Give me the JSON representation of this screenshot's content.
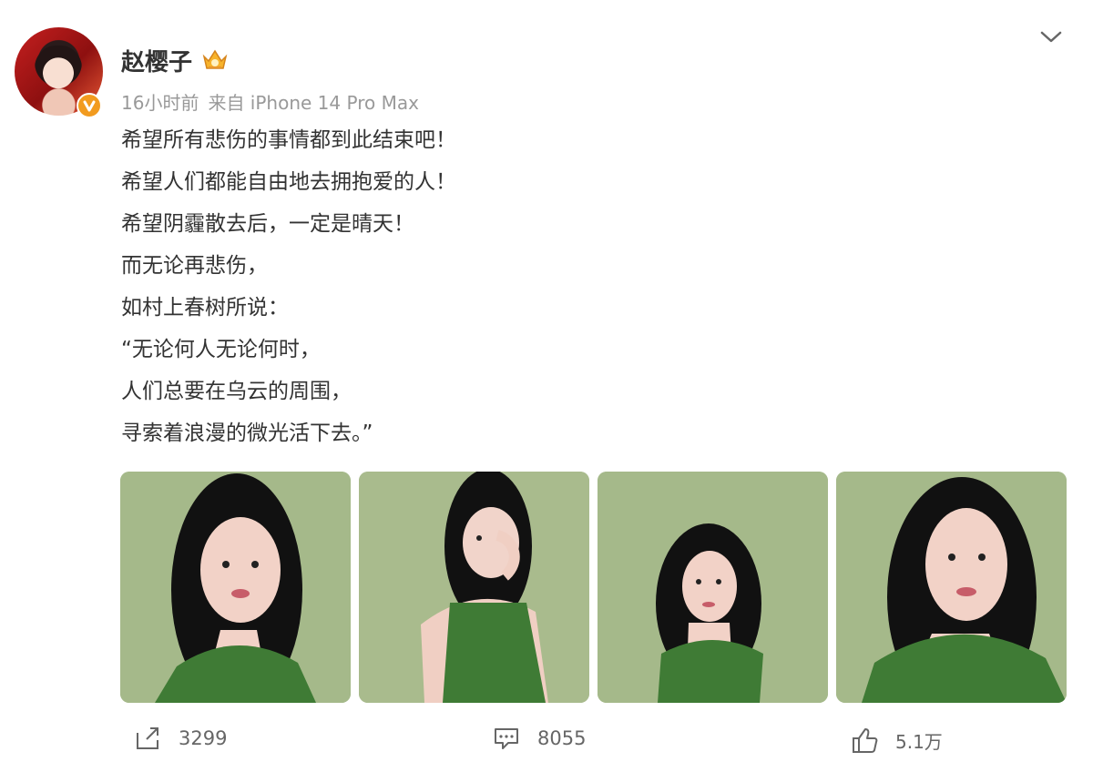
{
  "post": {
    "author": {
      "name": "赵樱子",
      "avatar_icon": "profile-avatar",
      "verified_icon": "verified-v-icon",
      "badge_icon": "crown-icon"
    },
    "meta": {
      "time": "16小时前",
      "source": "来自 iPhone 14 Pro Max"
    },
    "content_lines": [
      "希望所有悲伤的事情都到此结束吧！",
      "希望人们都能自由地去拥抱爱的人！",
      "希望阴霾散去后，一定是晴天！",
      "而无论再悲伤，",
      "如村上春树所说：",
      "“无论何人无论何时，",
      "人们总要在乌云的周围，",
      "寻索着浪漫的微光活下去。”"
    ],
    "images": [
      "photo-1",
      "photo-2",
      "photo-3",
      "photo-4"
    ],
    "actions": {
      "repost_count": "3299",
      "comment_count": "8055",
      "like_count": "5.1万"
    }
  },
  "colors": {
    "text": "#333333",
    "meta": "#999999",
    "action": "#666666",
    "photo_background": "#a5b98a",
    "verified_badge": "#f29b1f"
  }
}
